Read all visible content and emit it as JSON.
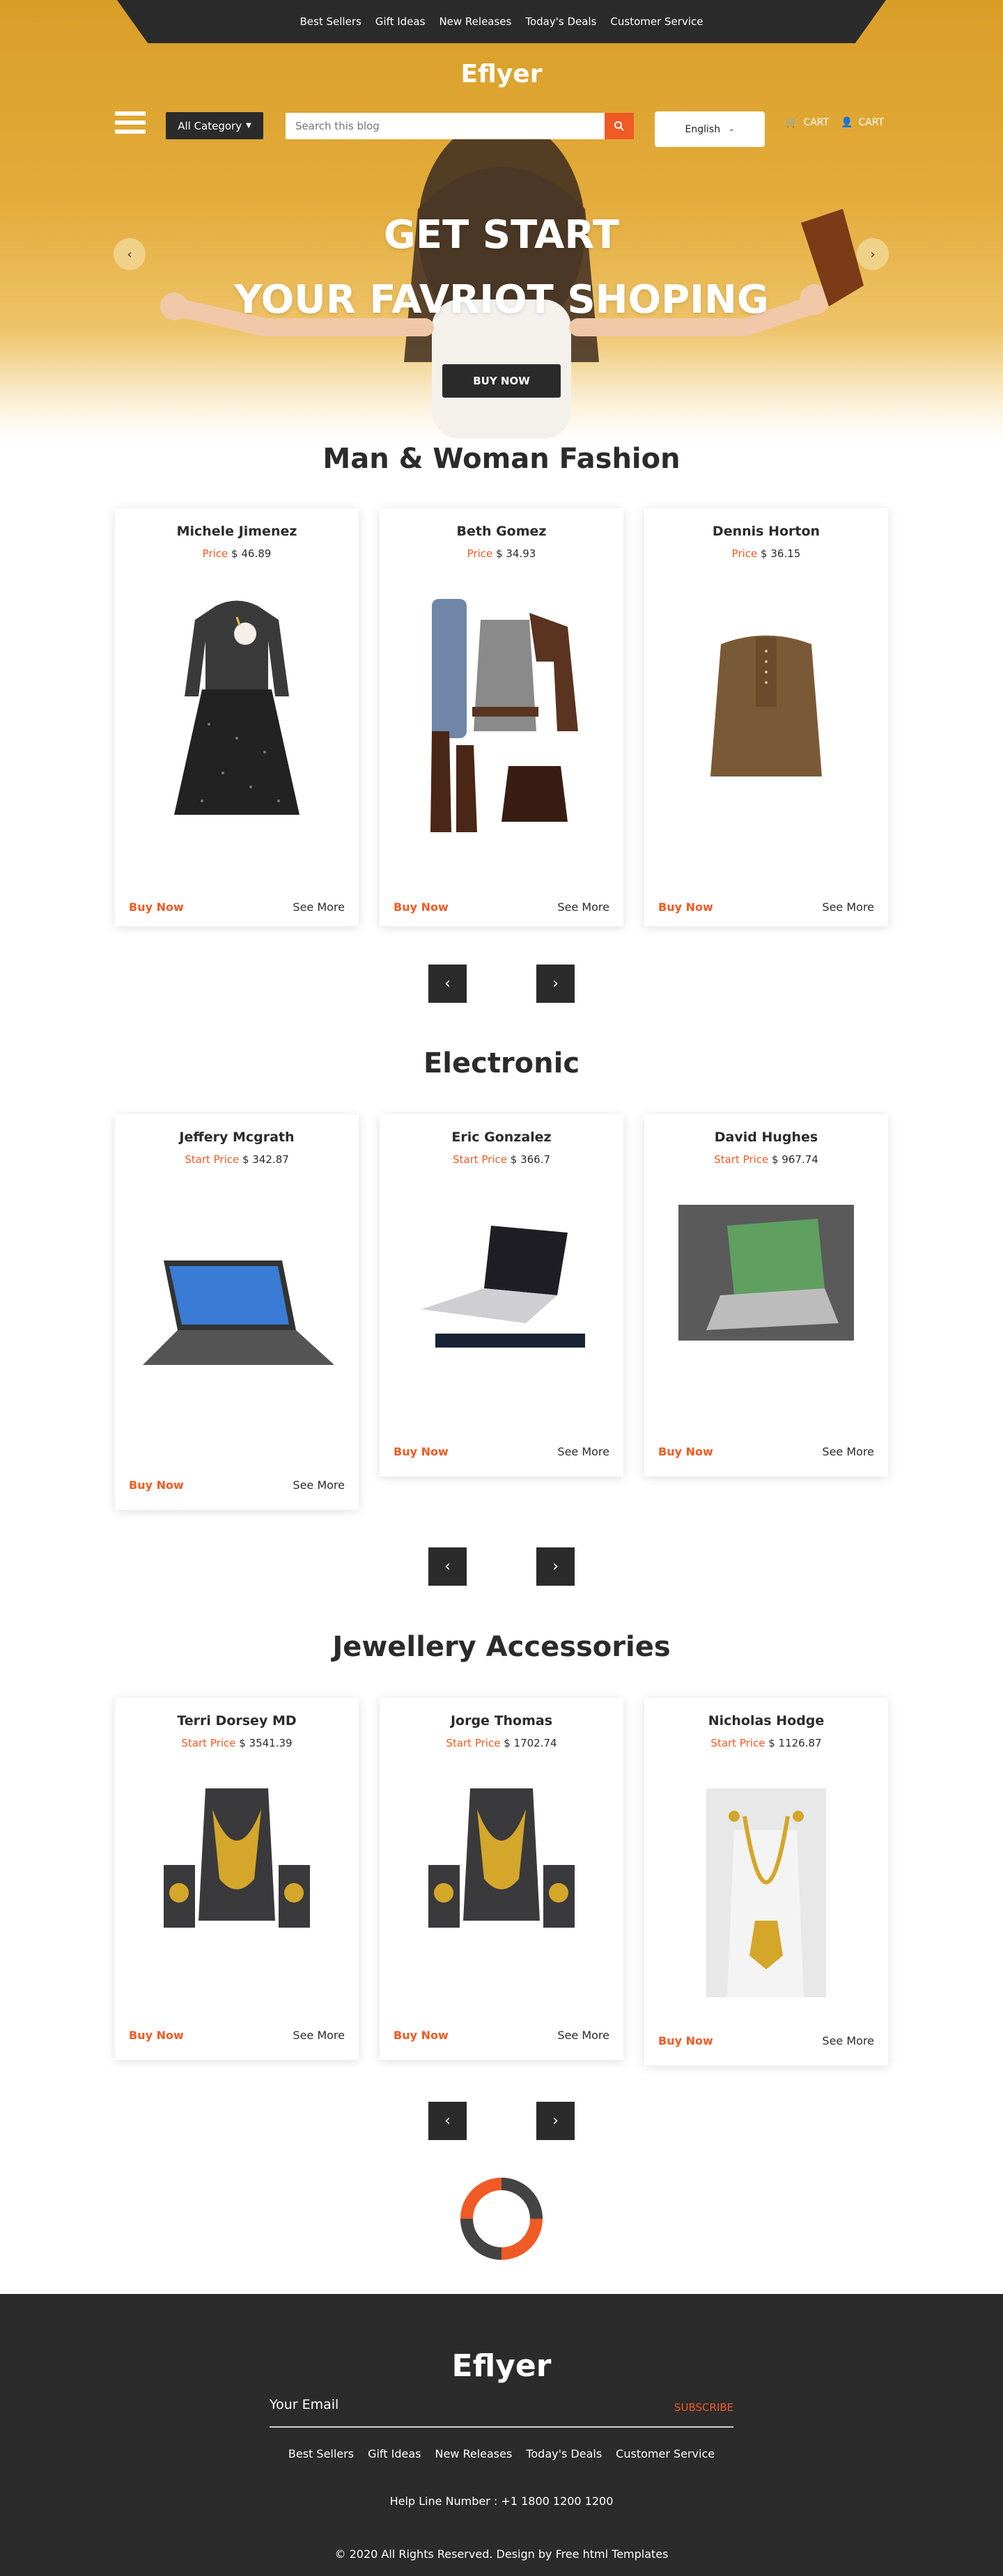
{
  "header": {
    "nav": [
      "Best Sellers",
      "Gift Ideas",
      "New Releases",
      "Today's Deals",
      "Customer Service"
    ],
    "brand": "Eflyer",
    "category_label": "All Category",
    "search_placeholder": "Search this blog",
    "language": "English",
    "cart_labels": [
      "CART",
      "CART"
    ]
  },
  "hero": {
    "line1": "GET START",
    "line2": "YOUR FAVRIOT SHOPING",
    "button": "BUY NOW",
    "prev": "‹",
    "next": "›"
  },
  "sections": [
    {
      "title": "Man & Woman Fashion",
      "products": [
        {
          "name": "Michele Jimenez",
          "price_label": "Price",
          "price": "$ 46.89",
          "image": "dress-image",
          "buy": "Buy Now",
          "more": "See More"
        },
        {
          "name": "Beth Gomez",
          "price_label": "Price",
          "price": "$ 34.93",
          "image": "outfit-image",
          "buy": "Buy Now",
          "more": "See More"
        },
        {
          "name": "Dennis Horton",
          "price_label": "Price",
          "price": "$ 36.15",
          "image": "kurta-image",
          "buy": "Buy Now",
          "more": "See More"
        }
      ]
    },
    {
      "title": "Electronic",
      "products": [
        {
          "name": "Jeffery Mcgrath",
          "price_label": "Start Price",
          "price": "$ 342.87",
          "image": "laptop-image",
          "buy": "Buy Now",
          "more": "See More"
        },
        {
          "name": "Eric Gonzalez",
          "price_label": "Start Price",
          "price": "$ 366.7",
          "image": "laptop-image",
          "buy": "Buy Now",
          "more": "See More"
        },
        {
          "name": "David Hughes",
          "price_label": "Start Price",
          "price": "$ 967.74",
          "image": "laptop-folder-image",
          "buy": "Buy Now",
          "more": "See More"
        }
      ]
    },
    {
      "title": "Jewellery Accessories",
      "products": [
        {
          "name": "Terri Dorsey MD",
          "price_label": "Start Price",
          "price": "$ 3541.39",
          "image": "necklace-image",
          "buy": "Buy Now",
          "more": "See More"
        },
        {
          "name": "Jorge Thomas",
          "price_label": "Start Price",
          "price": "$ 1702.74",
          "image": "necklace-image",
          "buy": "Buy Now",
          "more": "See More"
        },
        {
          "name": "Nicholas Hodge",
          "price_label": "Start Price",
          "price": "$ 1126.87",
          "image": "long-necklace-image",
          "buy": "Buy Now",
          "more": "See More"
        }
      ]
    }
  ],
  "pager": {
    "prev": "‹",
    "next": "›"
  },
  "footer": {
    "brand": "Eflyer",
    "email_placeholder": "Your Email",
    "subscribe": "SUBSCRIBE",
    "nav": [
      "Best Sellers",
      "Gift Ideas",
      "New Releases",
      "Today's Deals",
      "Customer Service"
    ],
    "helpline": "Help Line Number : +1 1800 1200 1200",
    "copyright": "© 2020 All Rights Reserved. Design by Free html Templates"
  },
  "colors": {
    "accent": "#f05a24",
    "dark": "#2b2b2b",
    "hero": "#e3ab3a"
  }
}
